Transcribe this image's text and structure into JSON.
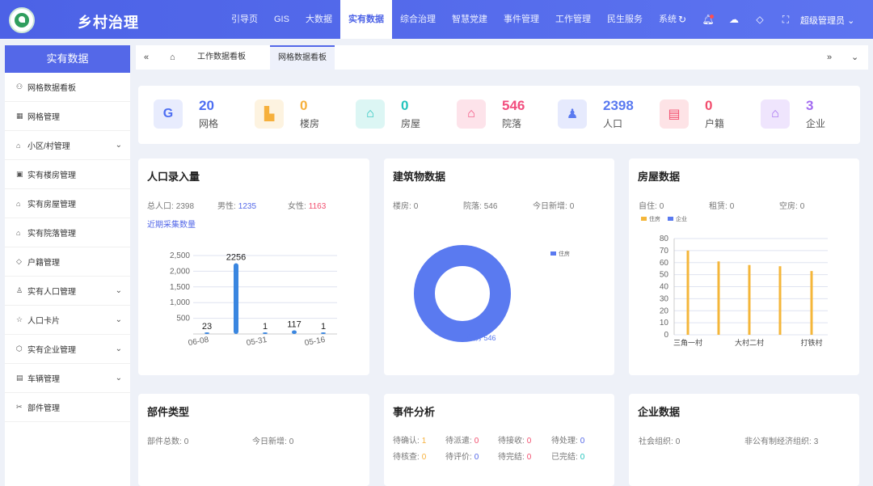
{
  "header": {
    "title": "乡村治理",
    "nav": [
      "引导页",
      "GIS",
      "大数据",
      "实有数据",
      "综合治理",
      "智慧党建",
      "事件管理",
      "工作管理",
      "民生服务",
      "系统"
    ],
    "active_nav": "实有数据",
    "user": "超级管理员"
  },
  "sidebar": {
    "title": "实有数据",
    "items": [
      {
        "label": "网格数据看板",
        "icon": "grid-icon",
        "chev": ""
      },
      {
        "label": "网格管理",
        "icon": "table-icon",
        "chev": ""
      },
      {
        "label": "小区/村管理",
        "icon": "home-icon",
        "chev": "⌄"
      },
      {
        "label": "实有楼房管理",
        "icon": "building-icon",
        "chev": ""
      },
      {
        "label": "实有房屋管理",
        "icon": "house-icon",
        "chev": ""
      },
      {
        "label": "实有院落管理",
        "icon": "yard-icon",
        "chev": ""
      },
      {
        "label": "户籍管理",
        "icon": "tag-icon",
        "chev": ""
      },
      {
        "label": "实有人口管理",
        "icon": "person-icon",
        "chev": "⌄"
      },
      {
        "label": "人口卡片",
        "icon": "card-icon",
        "chev": "⌄"
      },
      {
        "label": "实有企业管理",
        "icon": "enterprise-icon",
        "chev": "⌄"
      },
      {
        "label": "车辆管理",
        "icon": "car-icon",
        "chev": "⌄"
      },
      {
        "label": "部件管理",
        "icon": "tools-icon",
        "chev": ""
      }
    ]
  },
  "tabs": [
    "工作数据看板",
    "网格数据看板"
  ],
  "active_tab": "网格数据看板",
  "stats": [
    {
      "icon": "G",
      "value": "20",
      "label": "网格",
      "color": "#4d6ef2",
      "bg": "#e8ecfd"
    },
    {
      "icon": "▙",
      "value": "0",
      "label": "楼房",
      "color": "#f6b03c",
      "bg": "#fdf3e0"
    },
    {
      "icon": "⌂",
      "value": "0",
      "label": "房屋",
      "color": "#24c4bd",
      "bg": "#dcf6f4"
    },
    {
      "icon": "⌂",
      "value": "546",
      "label": "院落",
      "color": "#f24e7e",
      "bg": "#fde3ea"
    },
    {
      "icon": "♟",
      "value": "2398",
      "label": "人口",
      "color": "#5a7af0",
      "bg": "#e6eafd"
    },
    {
      "icon": "▤",
      "value": "0",
      "label": "户籍",
      "color": "#f24e6e",
      "bg": "#fde3e6"
    },
    {
      "icon": "⌂",
      "value": "3",
      "label": "企业",
      "color": "#a36cf0",
      "bg": "#efe5fd"
    }
  ],
  "population": {
    "title": "人口录入量",
    "total_label": "总人口:",
    "total": "2398",
    "male_label": "男性:",
    "male": "1235",
    "female_label": "女性:",
    "female": "1163",
    "link": "近期采集数量"
  },
  "building": {
    "title": "建筑物数据",
    "loufang_label": "楼房:",
    "loufang": "0",
    "yuanluo_label": "院落:",
    "yuanluo": "546",
    "new_label": "今日新增:",
    "new": "0"
  },
  "house": {
    "title": "房屋数据",
    "zizhu_label": "自住:",
    "zizhu": "0",
    "zulin_label": "租赁:",
    "zulin": "0",
    "kongfang_label": "空房:",
    "kongfang": "0"
  },
  "parts": {
    "title": "部件类型",
    "total_label": "部件总数:",
    "total": "0",
    "new_label": "今日新增:",
    "new": "0"
  },
  "events": {
    "title": "事件分析",
    "items": [
      {
        "label": "待确认:",
        "value": "1",
        "color": "#f6b03c"
      },
      {
        "label": "待派遣:",
        "value": "0",
        "color": "#f24e6e"
      },
      {
        "label": "待接收:",
        "value": "0",
        "color": "#f24e6e"
      },
      {
        "label": "待处理:",
        "value": "0",
        "color": "#5468e8"
      },
      {
        "label": "待核查:",
        "value": "0",
        "color": "#f6b03c"
      },
      {
        "label": "待评价:",
        "value": "0",
        "color": "#5468e8"
      },
      {
        "label": "待完结:",
        "value": "0",
        "color": "#f24e6e"
      },
      {
        "label": "已完结:",
        "value": "0",
        "color": "#24c4bd"
      }
    ]
  },
  "enterprise": {
    "title": "企业数据",
    "social_label": "社会组织:",
    "social": "0",
    "nonpublic_label": "非公有制经济组织:",
    "nonpublic": "3"
  },
  "chart_data": [
    {
      "type": "bar",
      "title": "近期采集数量",
      "categories": [
        "06-08",
        "",
        "05-31",
        "",
        "05-16",
        ""
      ],
      "values": [
        23,
        2256,
        1,
        117,
        1,
        0
      ],
      "data_labels": [
        "23",
        "2256",
        "1",
        "117",
        "1",
        ""
      ],
      "ylim": [
        0,
        2500
      ],
      "yticks": [
        500,
        "1,000",
        "1,500",
        "2,000",
        "2,500"
      ],
      "color": "#3a86e0"
    },
    {
      "type": "pie",
      "series": [
        {
          "name": "住房",
          "values": [
            546
          ]
        }
      ],
      "labels": [
        "住房 546"
      ],
      "legend": "住房",
      "color": "#5a7af0"
    },
    {
      "type": "bar",
      "categories": [
        "三角一村",
        "",
        "大村二村",
        "",
        "打铁村"
      ],
      "series": [
        {
          "name": "住房",
          "values": [
            70,
            61,
            58,
            57,
            53
          ],
          "color": "#f4b63a"
        },
        {
          "name": "企业",
          "values": [
            0,
            0,
            0,
            0,
            0
          ],
          "color": "#5a7af0"
        }
      ],
      "ylim": [
        0,
        80
      ],
      "yticks": [
        0,
        10,
        20,
        30,
        40,
        50,
        60,
        70,
        80
      ]
    }
  ]
}
